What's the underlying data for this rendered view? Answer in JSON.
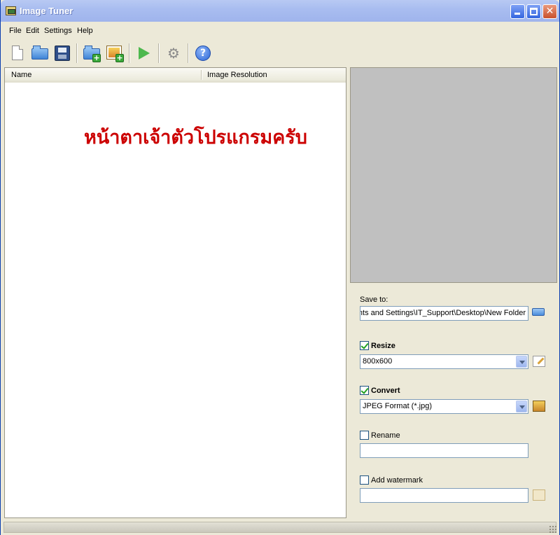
{
  "window": {
    "title": "Image Tuner"
  },
  "menu": [
    "File",
    "Edit",
    "Settings",
    "Help"
  ],
  "toolbar": {
    "icons": [
      "new-file-icon",
      "open-folder-icon",
      "save-icon",
      "add-folder-icon",
      "add-image-icon",
      "run-icon",
      "settings-gear-icon",
      "help-icon"
    ]
  },
  "list": {
    "columns": [
      "Name",
      "Image Resolution"
    ],
    "overlay_text": "หน้าตาเจ้าตัวโปรแกรมครับ"
  },
  "settings": {
    "save_to_label": "Save to:",
    "save_to_value": "C:\\Documents and Settings\\IT_Support\\Desktop\\New Folder",
    "resize_label": "Resize",
    "resize_checked": true,
    "resize_value": "800x600",
    "convert_label": "Convert",
    "convert_checked": true,
    "convert_value": "JPEG Format (*.jpg)",
    "rename_label": "Rename",
    "rename_checked": false,
    "rename_value": "",
    "watermark_label": "Add watermark",
    "watermark_checked": false,
    "watermark_value": ""
  },
  "colors": {
    "overlay_text": "#cc0000",
    "titlebar": "#a9bdf0",
    "preview": "#c0c0c0"
  }
}
